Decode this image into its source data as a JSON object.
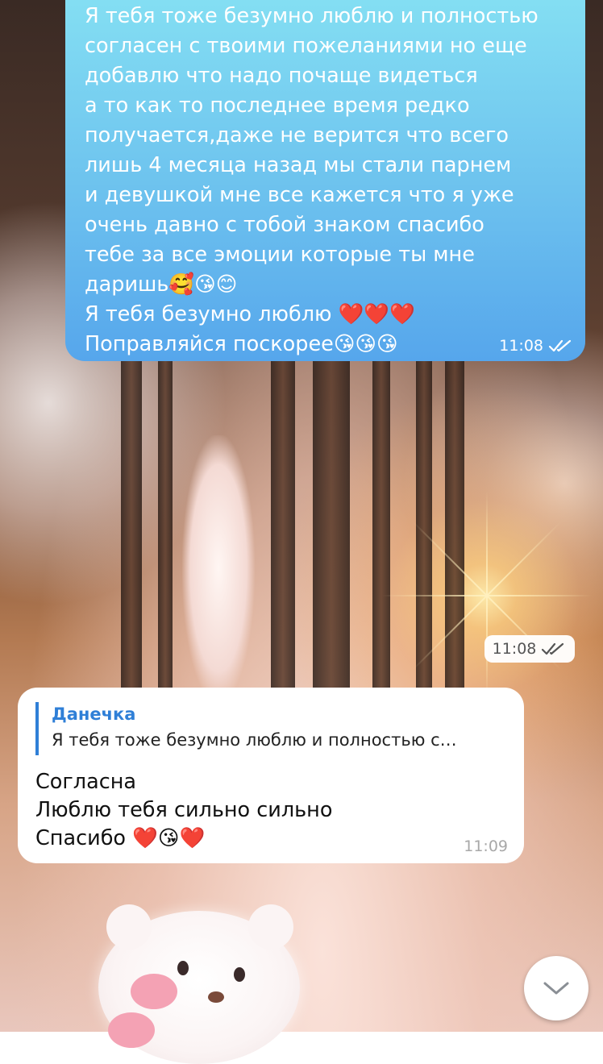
{
  "chat": {
    "outgoing_message": {
      "text": "Я тебя тоже безумно люблю и полностью\nсогласен с твоими пожеланиями но еще\nдобавлю что надо почаще видеться\nа то как то последнее время редко\nполучается,даже не верится что всего\nлишь 4 месяца назад мы стали парнем\nи девушкой мне все кажется что я уже\nочень давно с тобой знаком спасибо\nтебе за все эмоции которые ты мне\nдаришь🥰😘😊\nЯ тебя безумно люблю ❤️❤️❤️\nПоправляйся поскорее😘😘😘",
      "time": "11:08",
      "status_icon": "double-check-icon"
    },
    "sticker_message": {
      "time": "11:08",
      "status_icon": "double-check-icon"
    },
    "incoming_message": {
      "reply_author": "Данечка",
      "reply_preview": "Я тебя тоже безумно люблю и полностью с…",
      "text": "Согласна\nЛюблю тебя сильно сильно\nСпасибо ❤️😘❤️",
      "time": "11:09"
    },
    "scroll_down_icon": "chevron-down-icon"
  },
  "colors": {
    "outgoing_bubble_top": "#84dff3",
    "outgoing_bubble_bottom": "#56a6ec",
    "reply_accent": "#2f7fd7",
    "incoming_bubble": "#ffffff"
  }
}
